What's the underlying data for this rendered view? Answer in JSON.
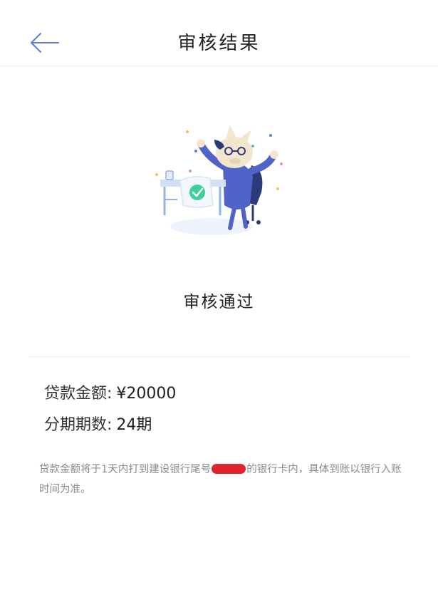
{
  "header": {
    "title": "审核结果",
    "back_icon": "arrow-left-icon"
  },
  "result": {
    "status_title": "审核通过",
    "illustration": "approved-mascot-illustration"
  },
  "loan": {
    "amount_label": "贷款金额:",
    "amount_value": "¥20000",
    "periods_label": "分期期数:",
    "periods_value": "24期"
  },
  "note": {
    "before_redaction": "贷款金额将于1天内打到建设银行尾号",
    "after_redaction": "的银行卡内，具体到账以银行入账时间为准。"
  },
  "colors": {
    "accent": "#5b7be8",
    "redaction": "#e0242c",
    "check_green": "#3ecf9a"
  }
}
